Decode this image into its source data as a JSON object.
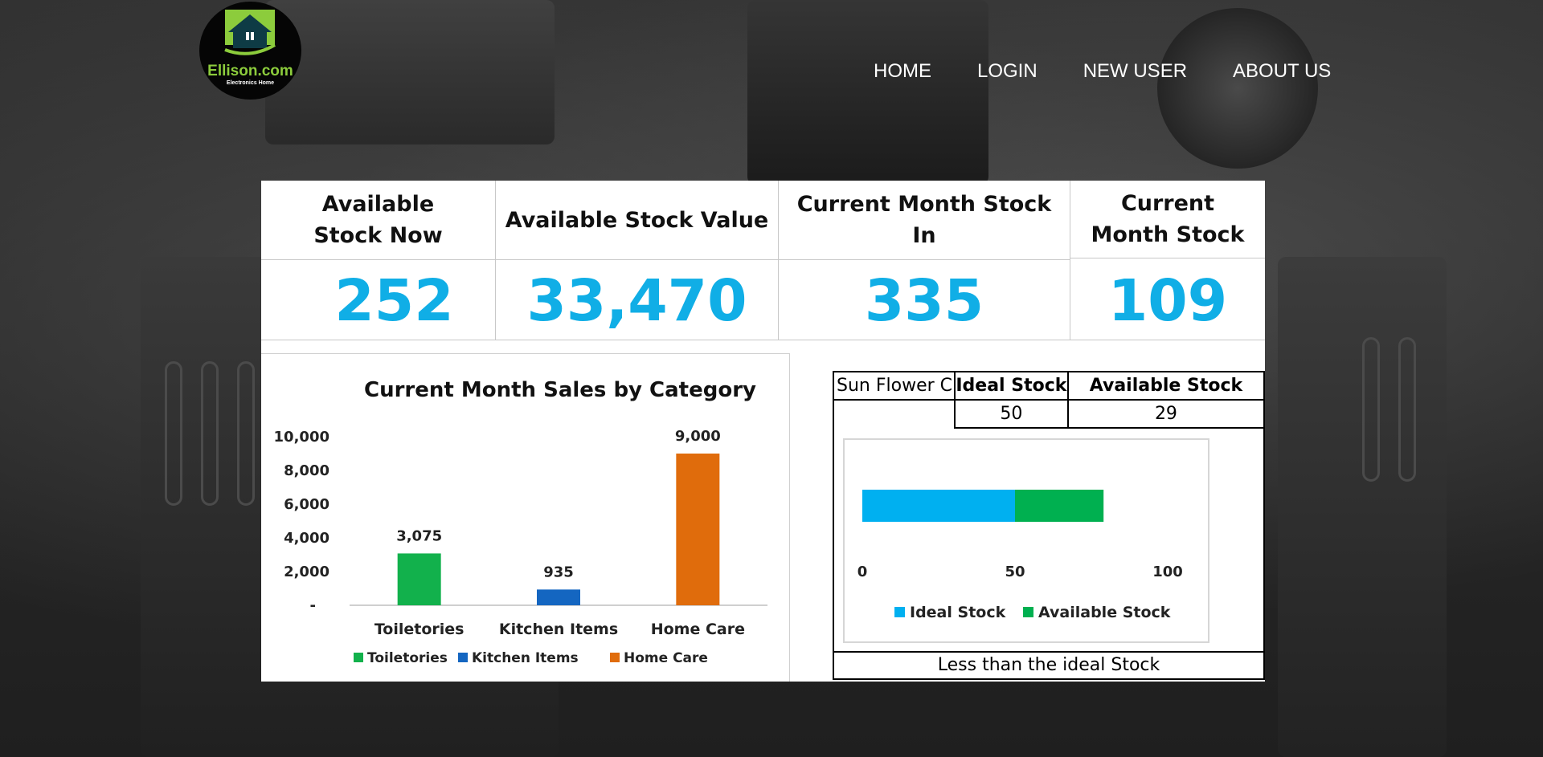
{
  "header": {
    "logo": {
      "name": "Ellison.com",
      "tagline": "Electronics Home"
    },
    "nav": [
      "HOME",
      "LOGIN",
      "NEW USER",
      "ABOUT US"
    ]
  },
  "kpis": [
    {
      "title": "Available Stock Now",
      "value": "252"
    },
    {
      "title": "Available Stock Value",
      "value": "33,470"
    },
    {
      "title": "Current Month Stock In",
      "value": "335"
    },
    {
      "title": "Current Month Stock",
      "value": "109"
    }
  ],
  "stock_table": {
    "product": "Sun Flower C",
    "ideal_header": "Ideal Stock",
    "available_header": "Available Stock",
    "ideal_value": "50",
    "available_value": "29",
    "status": "Less than the ideal Stock"
  },
  "chart_data": [
    {
      "type": "bar",
      "title": "Current Month Sales by Category",
      "categories": [
        "Toiletories",
        "Kitchen Items",
        "Home Care"
      ],
      "values": [
        3075,
        935,
        9000
      ],
      "value_labels": [
        "3,075",
        "935",
        "9,000"
      ],
      "colors": [
        "#12b14c",
        "#1466c1",
        "#e06c0c"
      ],
      "ylim": [
        0,
        10000
      ],
      "yticks": [
        "-",
        "2,000",
        "4,000",
        "6,000",
        "8,000",
        "10,000"
      ],
      "legend": [
        "Toiletories",
        "Kitchen Items",
        "Home Care"
      ],
      "legend_position": "bottom"
    },
    {
      "type": "bar",
      "orientation": "horizontal",
      "stacked": true,
      "series": [
        {
          "name": "Ideal Stock",
          "values": [
            50
          ],
          "color": "#00b0f0"
        },
        {
          "name": "Available Stock",
          "values": [
            29
          ],
          "color": "#00b050"
        }
      ],
      "xlim": [
        0,
        100
      ],
      "xticks": [
        "0",
        "50",
        "100"
      ],
      "legend_position": "bottom"
    }
  ]
}
